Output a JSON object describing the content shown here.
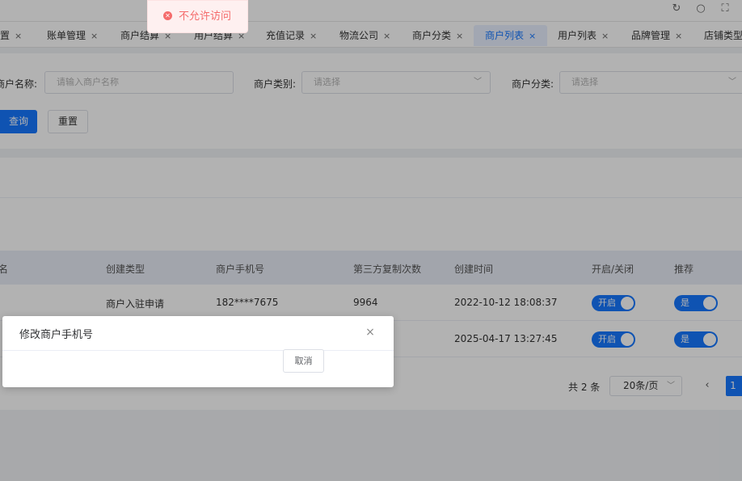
{
  "tabs": [
    {
      "label": "置"
    },
    {
      "label": "账单管理"
    },
    {
      "label": "商户结算"
    },
    {
      "label": "用户结算"
    },
    {
      "label": "充值记录"
    },
    {
      "label": "物流公司"
    },
    {
      "label": "商户分类"
    },
    {
      "label": "商户列表",
      "active": true
    },
    {
      "label": "用户列表"
    },
    {
      "label": "品牌管理"
    },
    {
      "label": "店铺类型"
    }
  ],
  "tab_close": "×",
  "filters": {
    "merchant_name_label": "商户名称:",
    "merchant_name_placeholder": "请输入商户名称",
    "merchant_type_label": "商户类别:",
    "merchant_type_placeholder": "请选择",
    "merchant_category_label": "商户分类:",
    "merchant_category_placeholder": "请选择",
    "query_label": "查询",
    "reset_label": "重置"
  },
  "table": {
    "headers": {
      "name": "名",
      "create_type": "创建类型",
      "phone": "商户手机号",
      "copy_count": "第三方复制次数",
      "created_at": "创建时间",
      "open_close": "开启/关闭",
      "recommend": "推荐"
    },
    "rows": [
      {
        "create_type": "商户入驻申请",
        "phone": "182****7675",
        "copy_count": "9964",
        "created_at": "2022-10-12 18:08:37",
        "switch_label": "开启",
        "recommend_label": "是"
      },
      {
        "create_type": "",
        "phone": "",
        "copy_count": "",
        "created_at": "2025-04-17 13:27:45",
        "switch_label": "开启",
        "recommend_label": "是"
      }
    ]
  },
  "pagination": {
    "total": "共 2 条",
    "page_size": "20条/页",
    "prev": "‹",
    "current_page": "1"
  },
  "toast": {
    "message": "不允许访问",
    "type": "error",
    "color": "#f56c6c"
  },
  "dialog": {
    "title": "修改商户手机号",
    "cancel_label": "取消",
    "close_glyph": "×"
  },
  "colors": {
    "primary": "#1677ff",
    "error": "#f56c6c"
  },
  "icons": [
    "refresh-icon",
    "search-icon",
    "fullscreen-icon",
    "close-icon",
    "chevron-down-icon",
    "error-circle-icon"
  ]
}
